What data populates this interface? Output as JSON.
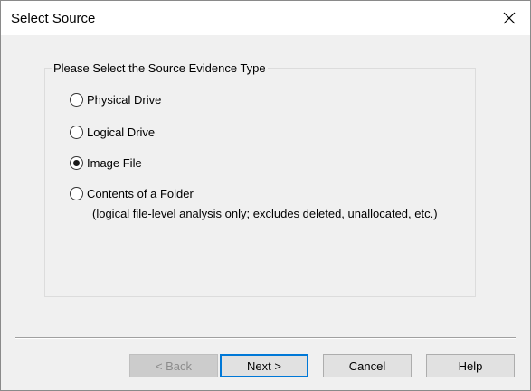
{
  "window": {
    "title": "Select Source",
    "close_glyph": "✕"
  },
  "group": {
    "legend": "Please Select the Source Evidence Type"
  },
  "options": [
    {
      "label": "Physical Drive",
      "selected": false
    },
    {
      "label": "Logical Drive",
      "selected": false
    },
    {
      "label": "Image File",
      "selected": true
    },
    {
      "label": "Contents of a Folder",
      "selected": false
    }
  ],
  "folder_note": "(logical file-level analysis only; excludes deleted, unallocated, etc.)",
  "buttons": {
    "back": "< Back",
    "next": "Next >",
    "cancel": "Cancel",
    "help": "Help"
  },
  "colors": {
    "accent": "#0078d7",
    "dialog_bg": "#f0f0f0",
    "titlebar_bg": "#ffffff"
  }
}
